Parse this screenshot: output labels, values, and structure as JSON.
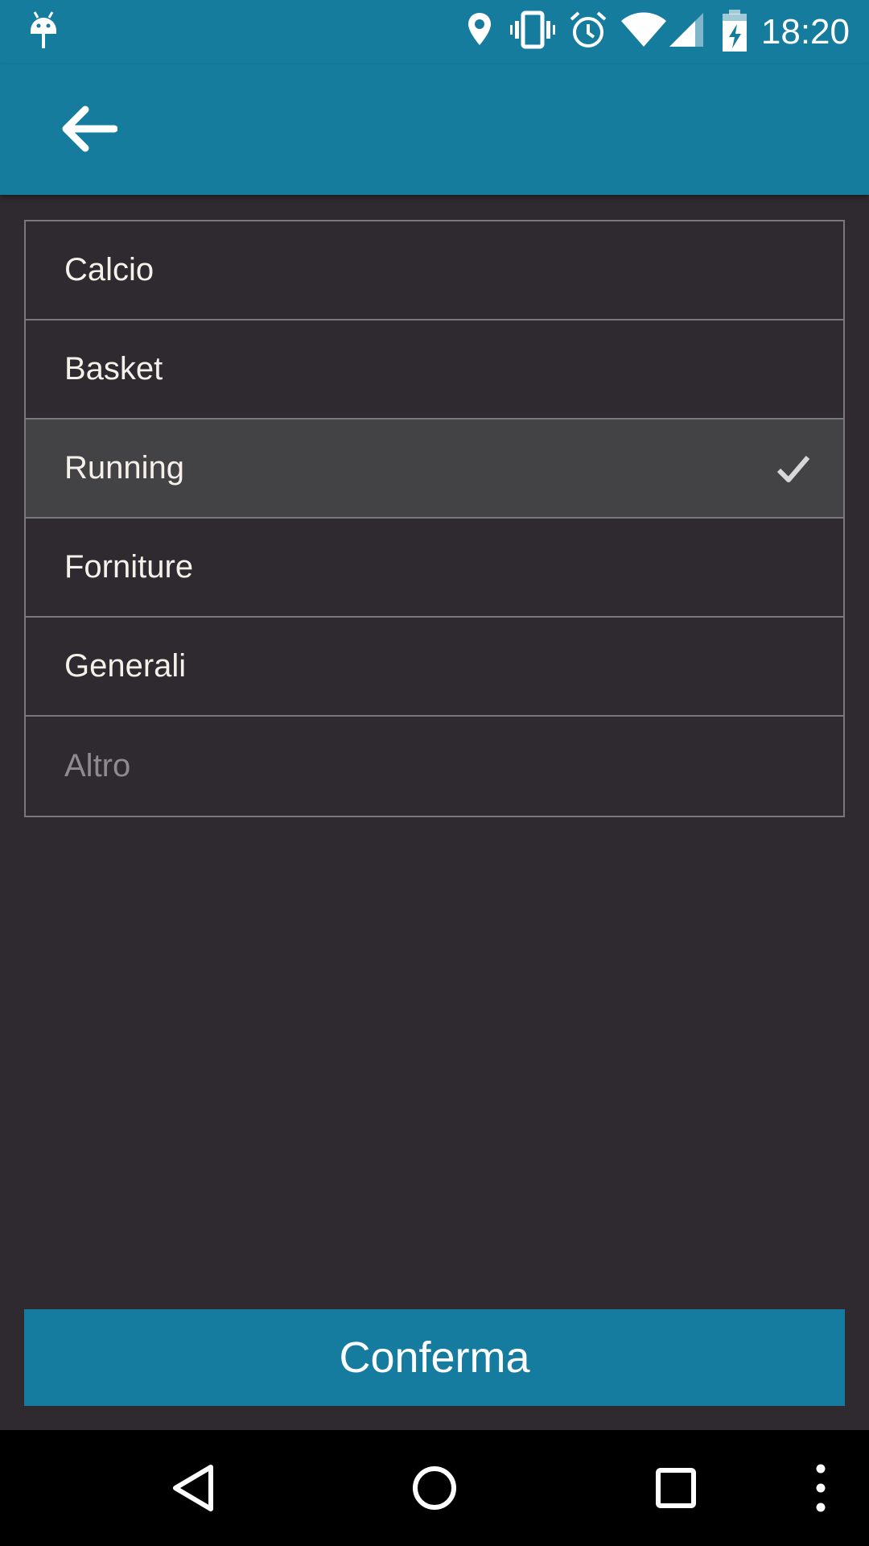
{
  "status_bar": {
    "time": "18:20",
    "icons": [
      "android-debug-icon",
      "location-icon",
      "vibrate-icon",
      "alarm-icon",
      "wifi-icon",
      "cell-signal-icon",
      "battery-charging-icon"
    ]
  },
  "app_bar": {
    "back_icon": "arrow-back-icon"
  },
  "options": [
    {
      "label": "Calcio",
      "selected": false,
      "enabled": true
    },
    {
      "label": "Basket",
      "selected": false,
      "enabled": true
    },
    {
      "label": "Running",
      "selected": true,
      "enabled": true
    },
    {
      "label": "Forniture",
      "selected": false,
      "enabled": true
    },
    {
      "label": "Generali",
      "selected": false,
      "enabled": true
    },
    {
      "label": "Altro",
      "selected": false,
      "enabled": false
    }
  ],
  "confirm_button": {
    "label": "Conferma"
  },
  "nav_bar": {
    "icons": [
      "back-triangle-icon",
      "home-circle-icon",
      "recents-square-icon",
      "overflow-menu-icon"
    ]
  },
  "colors": {
    "primary": "#167c9e",
    "background": "#2f2a2f",
    "selected_row": "#434244",
    "divider": "#7b787b"
  }
}
